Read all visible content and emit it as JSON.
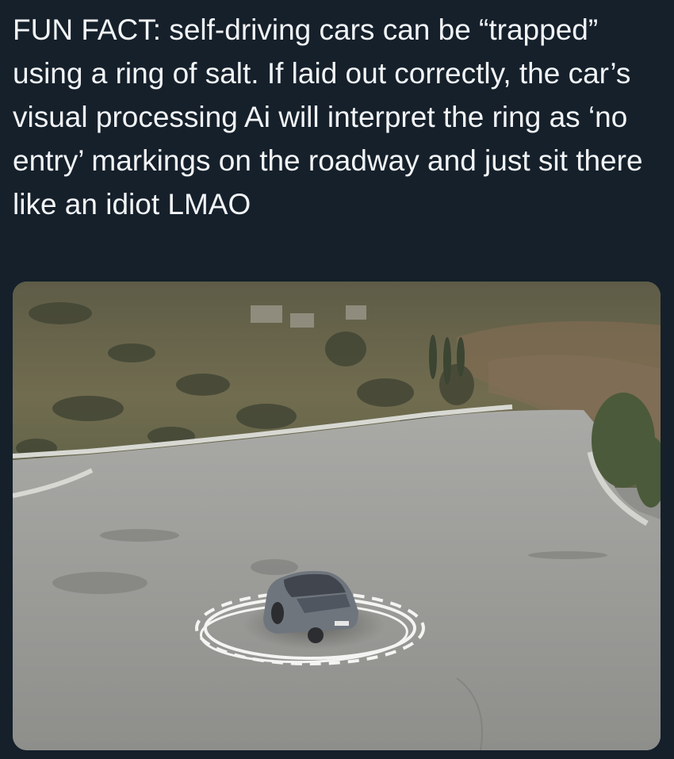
{
  "post": {
    "text": "FUN FACT: self-driving cars can be “trapped” using a ring of salt. If laid out correctly, the car’s visual processing Ai will interpret the ring as ‘no entry’ markings on the roadway and just sit there like an idiot LMAO"
  },
  "colors": {
    "background": "#15202b",
    "text": "#f2f4f6",
    "road": "#9b9b98",
    "hillside": "#6f6b4e",
    "car": "#6f757d",
    "salt_ring": "#f4f4f2"
  },
  "media": {
    "subject": "car inside salt ring on mountain road"
  }
}
